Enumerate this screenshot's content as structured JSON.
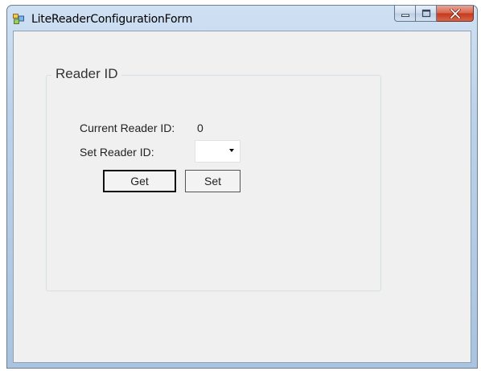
{
  "window": {
    "title": "LiteReaderConfigurationForm",
    "controls": {
      "minimize": "minimize-icon",
      "maximize": "maximize-icon",
      "close": "close-icon"
    }
  },
  "group": {
    "title": "Reader ID",
    "current_label": "Current Reader ID:",
    "current_value": "0",
    "set_label": "Set Reader ID:",
    "combo_value": "",
    "get_button": "Get",
    "set_button": "Set"
  },
  "colors": {
    "close_button": "#c6391c",
    "client_background": "#f0f0f0"
  }
}
